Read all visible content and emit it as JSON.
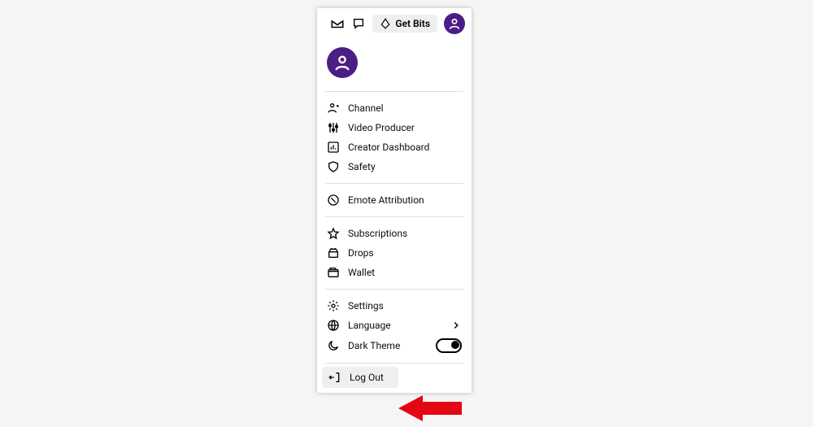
{
  "colors": {
    "accent": "#4b1e86",
    "arrow": "#e30613"
  },
  "topbar": {
    "get_bits_label": "Get Bits"
  },
  "menu": {
    "group1": [
      {
        "id": "channel",
        "label": "Channel"
      },
      {
        "id": "video-producer",
        "label": "Video Producer"
      },
      {
        "id": "creator-dashboard",
        "label": "Creator Dashboard"
      },
      {
        "id": "safety",
        "label": "Safety"
      }
    ],
    "group2": [
      {
        "id": "emote-attribution",
        "label": "Emote Attribution"
      }
    ],
    "group3": [
      {
        "id": "subscriptions",
        "label": "Subscriptions"
      },
      {
        "id": "drops",
        "label": "Drops"
      },
      {
        "id": "wallet",
        "label": "Wallet"
      }
    ],
    "group4": [
      {
        "id": "settings",
        "label": "Settings"
      },
      {
        "id": "language",
        "label": "Language",
        "chevron": true
      },
      {
        "id": "dark-theme",
        "label": "Dark Theme",
        "toggle": true
      }
    ],
    "logout_label": "Log Out"
  }
}
